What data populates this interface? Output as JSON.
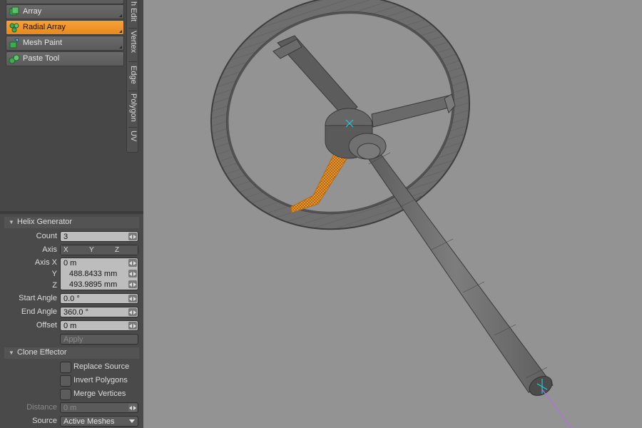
{
  "tools": {
    "items": [
      {
        "label": "Array",
        "icon": "array-tool-icon"
      },
      {
        "label": "Radial Array",
        "icon": "radial-array-icon",
        "selected": true
      },
      {
        "label": "Mesh Paint",
        "icon": "mesh-paint-icon"
      },
      {
        "label": "Paste Tool",
        "icon": "paste-tool-icon"
      }
    ]
  },
  "side_tabs": [
    "h Edit",
    "Vertex",
    "Edge",
    "Polygon",
    "UV"
  ],
  "helix": {
    "title": "Helix Generator",
    "count_label": "Count",
    "count_value": "3",
    "axis_label": "Axis",
    "axis_x": "X",
    "axis_y": "Y",
    "axis_z": "Z",
    "axisx_label": "Axis X",
    "axisx_value": "0 m",
    "y_label": "Y",
    "y_value": "488.8433 mm",
    "z_label": "Z",
    "z_value": "493.9895 mm",
    "start_angle_label": "Start Angle",
    "start_angle_value": "0.0 °",
    "end_angle_label": "End Angle",
    "end_angle_value": "360.0 °",
    "offset_label": "Offset",
    "offset_value": "0 m",
    "apply_label": "Apply"
  },
  "clone": {
    "title": "Clone Effector",
    "replace_source": "Replace Source",
    "invert_polygons": "Invert Polygons",
    "merge_vertices": "Merge Vertices",
    "distance_label": "Distance",
    "distance_value": "0 m",
    "source_label": "Source",
    "source_value": "Active Meshes"
  },
  "colors": {
    "selection": "#f29a2e",
    "viewport_bg": "#939393",
    "mesh": "#6f6f6f"
  }
}
